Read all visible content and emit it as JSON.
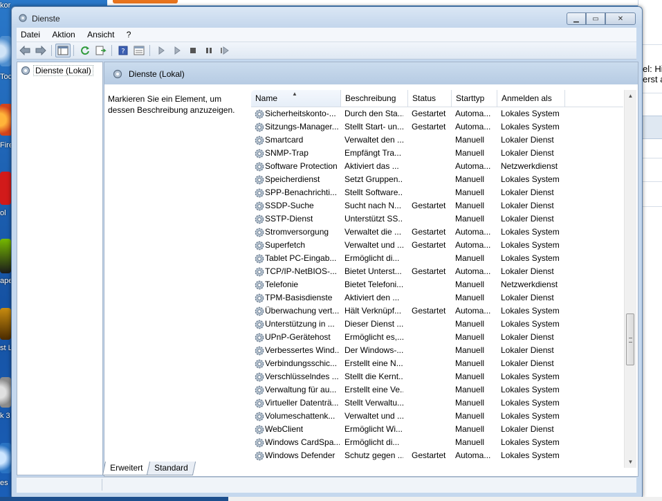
{
  "window": {
    "title": "Dienste"
  },
  "menu": [
    "Datei",
    "Aktion",
    "Ansicht",
    "?"
  ],
  "tree": {
    "root_label": "Dienste (Lokal)"
  },
  "panel": {
    "header": "Dienste (Lokal)",
    "description": "Markieren Sie ein Element, um dessen Beschreibung anzuzeigen."
  },
  "columns": [
    "Name",
    "Beschreibung",
    "Status",
    "Starttyp",
    "Anmelden als"
  ],
  "services": [
    [
      "Sicherheitskonto-...",
      "Durch den Sta...",
      "Gestartet",
      "Automa...",
      "Lokales System"
    ],
    [
      "Sitzungs-Manager...",
      "Stellt Start- un...",
      "Gestartet",
      "Automa...",
      "Lokales System"
    ],
    [
      "Smartcard",
      "Verwaltet den ...",
      "",
      "Manuell",
      "Lokaler Dienst"
    ],
    [
      "SNMP-Trap",
      "Empfängt Tra...",
      "",
      "Manuell",
      "Lokaler Dienst"
    ],
    [
      "Software Protection",
      "Aktiviert das ...",
      "",
      "Automa...",
      "Netzwerkdienst"
    ],
    [
      "Speicherdienst",
      "Setzt Gruppen...",
      "",
      "Manuell",
      "Lokales System"
    ],
    [
      "SPP-Benachrichti...",
      "Stellt Software...",
      "",
      "Manuell",
      "Lokaler Dienst"
    ],
    [
      "SSDP-Suche",
      "Sucht nach N...",
      "Gestartet",
      "Manuell",
      "Lokaler Dienst"
    ],
    [
      "SSTP-Dienst",
      "Unterstützt SS...",
      "",
      "Manuell",
      "Lokaler Dienst"
    ],
    [
      "Stromversorgung",
      "Verwaltet die ...",
      "Gestartet",
      "Automa...",
      "Lokales System"
    ],
    [
      "Superfetch",
      "Verwaltet und ...",
      "Gestartet",
      "Automa...",
      "Lokales System"
    ],
    [
      "Tablet PC-Eingab...",
      "Ermöglicht di...",
      "",
      "Manuell",
      "Lokales System"
    ],
    [
      "TCP/IP-NetBIOS-...",
      "Bietet Unterst...",
      "Gestartet",
      "Automa...",
      "Lokaler Dienst"
    ],
    [
      "Telefonie",
      "Bietet Telefoni...",
      "",
      "Manuell",
      "Netzwerkdienst"
    ],
    [
      "TPM-Basisdienste",
      "Aktiviert den ...",
      "",
      "Manuell",
      "Lokaler Dienst"
    ],
    [
      "Überwachung vert...",
      "Hält Verknüpf...",
      "Gestartet",
      "Automa...",
      "Lokales System"
    ],
    [
      "Unterstützung in ...",
      "Dieser Dienst ...",
      "",
      "Manuell",
      "Lokales System"
    ],
    [
      "UPnP-Gerätehost",
      "Ermöglicht es,...",
      "",
      "Manuell",
      "Lokaler Dienst"
    ],
    [
      "Verbessertes Wind...",
      "Der Windows-...",
      "",
      "Manuell",
      "Lokaler Dienst"
    ],
    [
      "Verbindungsschic...",
      "Erstellt eine N...",
      "",
      "Manuell",
      "Lokaler Dienst"
    ],
    [
      "Verschlüsselndes ...",
      "Stellt die Kernt...",
      "",
      "Manuell",
      "Lokales System"
    ],
    [
      "Verwaltung für au...",
      "Erstellt eine Ve...",
      "",
      "Manuell",
      "Lokales System"
    ],
    [
      "Virtueller Datenträ...",
      "Stellt Verwaltu...",
      "",
      "Manuell",
      "Lokales System"
    ],
    [
      "Volumeschattenk...",
      "Verwaltet und ...",
      "",
      "Manuell",
      "Lokales System"
    ],
    [
      "WebClient",
      "Ermöglicht Wi...",
      "",
      "Manuell",
      "Lokaler Dienst"
    ],
    [
      "Windows CardSpa...",
      "Ermöglicht di...",
      "",
      "Manuell",
      "Lokales System"
    ],
    [
      "Windows Defender",
      "Schutz gegen ...",
      "Gestartet",
      "Automa...",
      "Lokales System"
    ]
  ],
  "tabs": [
    "Erweitert",
    "Standard"
  ],
  "background_window": {
    "text_line1": "el: Hi",
    "text_line2": "erst a"
  },
  "desktop_labels": [
    "kor",
    "Toc",
    "Fire",
    "ol",
    "ape",
    "st L",
    "k 3",
    "es"
  ]
}
